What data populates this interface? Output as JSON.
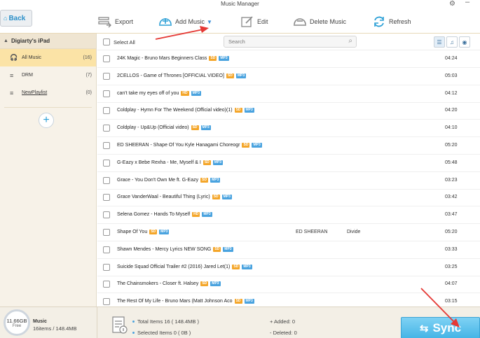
{
  "window": {
    "title": "Music Manager"
  },
  "nav": {
    "back_label": "Back"
  },
  "toolbar": {
    "export": "Export",
    "add_music": "Add Music",
    "edit": "Edit",
    "delete_music": "Delete Music",
    "refresh": "Refresh"
  },
  "sidebar": {
    "device": "Digiarty's iPad",
    "items": [
      {
        "label": "All Music",
        "count": "(16)"
      },
      {
        "label": "DRM",
        "count": "(7)"
      },
      {
        "label": "NewPlaylist",
        "count": "(0)"
      }
    ]
  },
  "list": {
    "select_all": "Select All",
    "search_placeholder": "Search",
    "rows": [
      {
        "title": "24K Magic - Bruno Mars   Beginners Class",
        "quality": "SD",
        "format": "MP3",
        "artist": "",
        "album": "",
        "duration": "04:24"
      },
      {
        "title": "2CELLOS - Game of Thrones [OFFICIAL VIDEO]",
        "quality": "SD",
        "format": "MP3",
        "artist": "",
        "album": "",
        "duration": "05:03"
      },
      {
        "title": "can't take my eyes off of you",
        "quality": "HD",
        "format": "MP3",
        "artist": "",
        "album": "",
        "duration": "04:12"
      },
      {
        "title": "Coldplay - Hymn For The Weekend (Official video)(1)",
        "quality": "SD",
        "format": "MP3",
        "artist": "",
        "album": "",
        "duration": "04:20"
      },
      {
        "title": "Coldplay - Up&Up (Official video)",
        "quality": "SD",
        "format": "MP3",
        "artist": "",
        "album": "",
        "duration": "04:10"
      },
      {
        "title": "ED SHEERAN - Shape Of You   Kyle Hanagami Choreogr",
        "quality": "SD",
        "format": "MP3",
        "artist": "",
        "album": "",
        "duration": "05:20"
      },
      {
        "title": "G-Eazy x Bebe Rexha - Me, Myself & I",
        "quality": "SD",
        "format": "MP3",
        "artist": "",
        "album": "",
        "duration": "05:48"
      },
      {
        "title": "Grace - You Don't Own Me ft. G-Eazy",
        "quality": "SD",
        "format": "MP3",
        "artist": "",
        "album": "",
        "duration": "03:23"
      },
      {
        "title": "Grace VanderWaal - Beautiful Thing (Lyric)",
        "quality": "SD",
        "format": "MP3",
        "artist": "",
        "album": "",
        "duration": "03:42"
      },
      {
        "title": "Selena Gomez - Hands To Myself",
        "quality": "HD",
        "format": "MP3",
        "artist": "",
        "album": "",
        "duration": "03:47"
      },
      {
        "title": "Shape Of You",
        "quality": "SD",
        "format": "MP3",
        "artist": "ED SHEERAN",
        "album": "Divide",
        "duration": "05:20"
      },
      {
        "title": "Shawn Mendes - Mercy Lyrics NEW SONG",
        "quality": "SD",
        "format": "MP3",
        "artist": "",
        "album": "",
        "duration": "03:33"
      },
      {
        "title": "Suicide Squad Official Trailer #2 (2016) Jared Let(1)",
        "quality": "SD",
        "format": "MP3",
        "artist": "",
        "album": "",
        "duration": "03:25"
      },
      {
        "title": "The Chainsmokers - Closer ft. Halsey",
        "quality": "SD",
        "format": "MP3",
        "artist": "",
        "album": "",
        "duration": "04:07"
      },
      {
        "title": "The Rest Of My Life - Bruno Mars (Matt Johnson Aco",
        "quality": "SD",
        "format": "MP3",
        "artist": "",
        "album": "",
        "duration": "03:15"
      }
    ]
  },
  "footer": {
    "storage_size": "11.66GB",
    "storage_free": "Free",
    "category": "Music",
    "items_summary": "16items / 148.4MB",
    "total_items": "Total Items 16 ( 148.4MB )",
    "selected_items": "Selected Items 0 ( 0B )",
    "added": "+ Added: 0",
    "deleted": "- Deleted: 0",
    "sync_label": "Sync"
  },
  "colors": {
    "accent": "#2a9fd6",
    "badge_quality": "#f4a62a",
    "badge_format": "#4aa3df",
    "sidebar_active": "#fbe3a6",
    "annotation_arrow": "#e53935"
  }
}
